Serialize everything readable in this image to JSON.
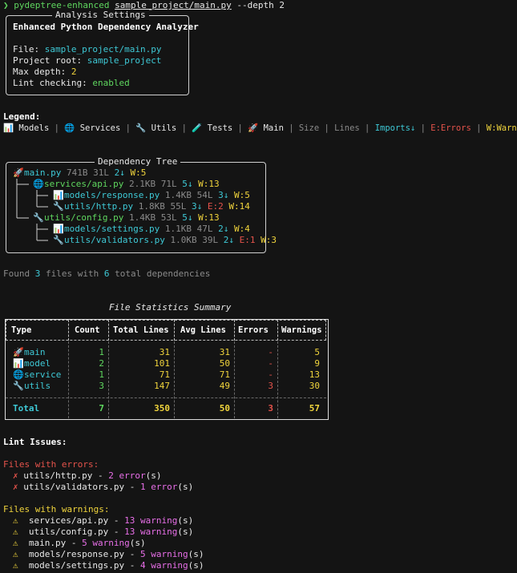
{
  "command": {
    "prompt": "❯",
    "program": "pydeptree-enhanced",
    "arg_file": "sample_project/main.py",
    "arg_flag": "--depth 2"
  },
  "settings": {
    "title": "Analysis Settings",
    "heading": "Enhanced Python Dependency Analyzer",
    "file_label": "File: ",
    "file_value": "sample_project/main.py",
    "root_label": "Project root: ",
    "root_value": "sample_project",
    "depth_label": "Max depth: ",
    "depth_value": "2",
    "lint_label": "Lint checking: ",
    "lint_value": "enabled"
  },
  "legend": {
    "title": "Legend:",
    "models": "📊 Models",
    "services": "🌐 Services",
    "utils": "🔧 Utils",
    "tests": "🧪 Tests",
    "main": "🚀 Main",
    "size": "Size",
    "lines": "Lines",
    "imports": "Imports↓",
    "errors": "E:Errors",
    "warnings": "W:Warnings",
    "sep": " | "
  },
  "tree": {
    "title": "Dependency Tree",
    "nodes": [
      {
        "icon": "🚀",
        "name": "main.py",
        "size": "741B",
        "lines": "31L",
        "imports": "2↓",
        "err": "",
        "warn": "W:5"
      },
      {
        "icon": "🌐",
        "name": "services/api.py",
        "size": "2.1KB",
        "lines": "71L",
        "imports": "5↓",
        "err": "",
        "warn": "W:13"
      },
      {
        "icon": "📊",
        "name": "models/response.py",
        "size": "1.4KB",
        "lines": "54L",
        "imports": "3↓",
        "err": "",
        "warn": "W:5"
      },
      {
        "icon": "🔧",
        "name": "utils/http.py",
        "size": "1.8KB",
        "lines": "55L",
        "imports": "3↓",
        "err": "E:2",
        "warn": "W:14"
      },
      {
        "icon": "🔧",
        "name": "utils/config.py",
        "size": "1.4KB",
        "lines": "53L",
        "imports": "5↓",
        "err": "",
        "warn": "W:13"
      },
      {
        "icon": "📊",
        "name": "models/settings.py",
        "size": "1.1KB",
        "lines": "47L",
        "imports": "2↓",
        "err": "",
        "warn": "W:4"
      },
      {
        "icon": "🔧",
        "name": "utils/validators.py",
        "size": "1.0KB",
        "lines": "39L",
        "imports": "2↓",
        "err": "E:1",
        "warn": "W:3"
      }
    ]
  },
  "found": {
    "pre": "Found ",
    "files": "3",
    "mid": " files with ",
    "deps": "6",
    "post": " total dependencies"
  },
  "stats": {
    "title": "File Statistics Summary",
    "headers": [
      "Type",
      "Count",
      "Total Lines",
      "Avg Lines",
      "Errors",
      "Warnings"
    ],
    "rows": [
      {
        "icon": "🚀",
        "type": "main",
        "count": "1",
        "total": "31",
        "avg": "31",
        "errors": "-",
        "warnings": "5"
      },
      {
        "icon": "📊",
        "type": "model",
        "count": "2",
        "total": "101",
        "avg": "50",
        "errors": "-",
        "warnings": "9"
      },
      {
        "icon": "🌐",
        "type": "service",
        "count": "1",
        "total": "71",
        "avg": "71",
        "errors": "-",
        "warnings": "13"
      },
      {
        "icon": "🔧",
        "type": "utils",
        "count": "3",
        "total": "147",
        "avg": "49",
        "errors": "3",
        "warnings": "30"
      }
    ],
    "total": {
      "type": "Total",
      "count": "7",
      "total": "350",
      "avg": "50",
      "errors": "3",
      "warnings": "57"
    }
  },
  "lint": {
    "title": "Lint Issues:",
    "errors_title": "Files with errors:",
    "error_items": [
      {
        "mark": "✗",
        "file": "utils/http.py",
        "sep": " - ",
        "count": "2",
        "word": "error",
        "suffix": "(s)"
      },
      {
        "mark": "✗",
        "file": "utils/validators.py",
        "sep": " - ",
        "count": "1",
        "word": "error",
        "suffix": "(s)"
      }
    ],
    "warnings_title": "Files with warnings:",
    "warning_items": [
      {
        "mark": "⚠",
        "file": "services/api.py",
        "sep": " - ",
        "count": "13",
        "word": "warning",
        "suffix": "(s)"
      },
      {
        "mark": "⚠",
        "file": "utils/config.py",
        "sep": " - ",
        "count": "13",
        "word": "warning",
        "suffix": "(s)"
      },
      {
        "mark": "⚠",
        "file": "main.py",
        "sep": " - ",
        "count": "5",
        "word": "warning",
        "suffix": "(s)"
      },
      {
        "mark": "⚠",
        "file": "models/response.py",
        "sep": " - ",
        "count": "5",
        "word": "warning",
        "suffix": "(s)"
      },
      {
        "mark": "⚠",
        "file": "models/settings.py",
        "sep": " - ",
        "count": "4",
        "word": "warning",
        "suffix": "(s)"
      }
    ]
  }
}
